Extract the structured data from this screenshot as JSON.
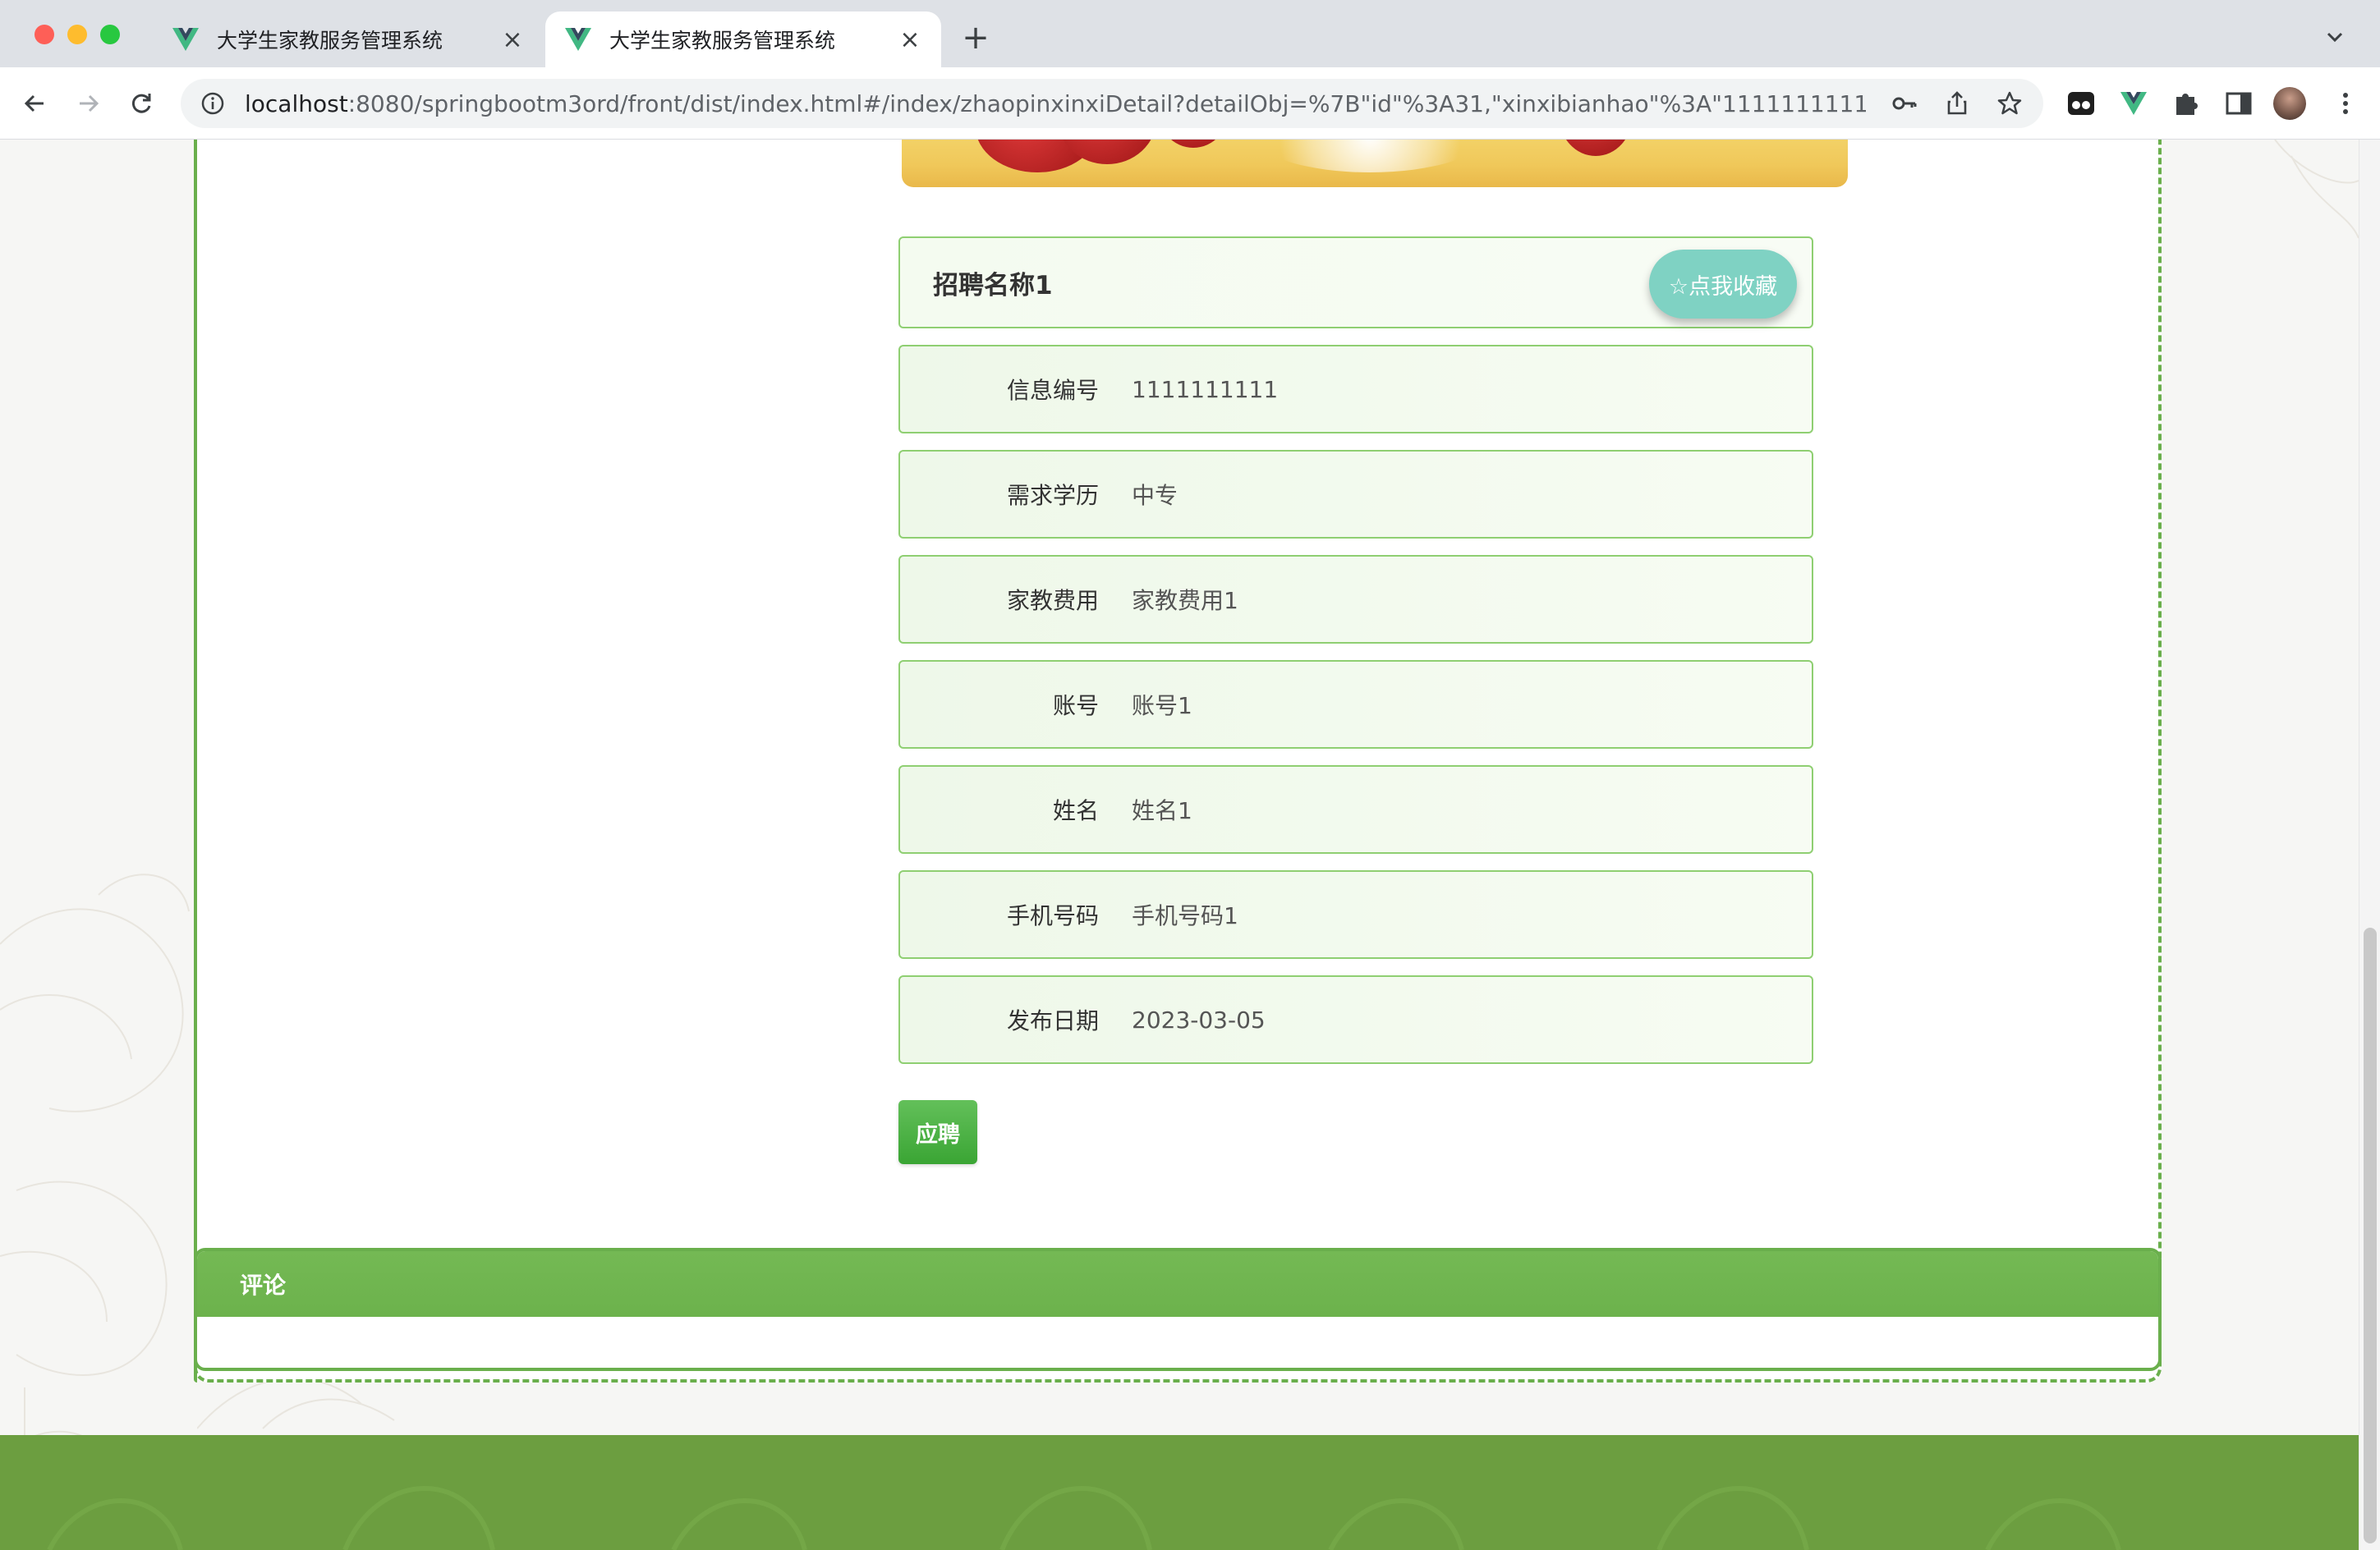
{
  "browser": {
    "tabs": [
      {
        "title": "大学生家教服务管理系统",
        "active": false
      },
      {
        "title": "大学生家教服务管理系统",
        "active": true
      }
    ],
    "new_tab_label": "+",
    "close_glyph": "×",
    "url_host": "localhost",
    "url_path": ":8080/springbootm3ord/front/dist/index.html#/index/zhaopinxinxiDetail?detailObj=%7B\"id\"%3A31,\"xinxibianhao\"%3A\"1111111111\",\"zhaopinmi..."
  },
  "detail": {
    "title": "招聘名称1",
    "favorite_label": "☆点我收藏",
    "fields": [
      {
        "label": "信息编号",
        "value": "1111111111"
      },
      {
        "label": "需求学历",
        "value": "中专"
      },
      {
        "label": "家教费用",
        "value": "家教费用1"
      },
      {
        "label": "账号",
        "value": "账号1"
      },
      {
        "label": "姓名",
        "value": "姓名1"
      },
      {
        "label": "手机号码",
        "value": "手机号码1"
      },
      {
        "label": "发布日期",
        "value": "2023-03-05"
      }
    ],
    "apply_label": "应聘"
  },
  "comments": {
    "header": "评论"
  },
  "colors": {
    "accent_green": "#6aaf4c",
    "apply_button": "#3aa534",
    "favorite_button": "#7fd2c3",
    "footer": "#6c9e40"
  }
}
